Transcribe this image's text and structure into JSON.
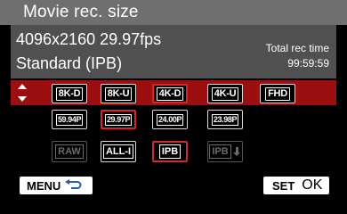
{
  "header": {
    "title": "Movie rec. size"
  },
  "info": {
    "resolution": "4096x2160 29.97fps",
    "quality": "Standard (IPB)",
    "rec_time_label": "Total rec time",
    "rec_time_value": "99:59:59"
  },
  "size_options": [
    {
      "label": "8K-D",
      "selected": false
    },
    {
      "label": "8K-U",
      "selected": false
    },
    {
      "label": "4K-D",
      "selected": true
    },
    {
      "label": "4K-U",
      "selected": false
    },
    {
      "label": "FHD",
      "selected": false
    }
  ],
  "fps_options": [
    {
      "label": "59.94P",
      "selected": false
    },
    {
      "label": "29.97P",
      "selected": true
    },
    {
      "label": "24.00P",
      "selected": false
    },
    {
      "label": "23.98P",
      "selected": false
    }
  ],
  "compression_options": [
    {
      "label": "RAW",
      "enabled": false,
      "selected": false
    },
    {
      "label": "ALL-I",
      "enabled": true,
      "selected": false
    },
    {
      "label": "IPB",
      "enabled": true,
      "selected": true
    },
    {
      "label": "IPB",
      "enabled": false,
      "selected": false,
      "icon": "download-arrow-icon"
    }
  ],
  "footer": {
    "menu_label": "MENU",
    "menu_icon": "return-arrow-icon",
    "set_label": "SET",
    "ok_label": "OK"
  },
  "colors": {
    "title_bar": "#6f6f6f",
    "info_panel": "#505050",
    "selected_row": "#9c0f10",
    "selected_outline": "#d22a2a"
  }
}
